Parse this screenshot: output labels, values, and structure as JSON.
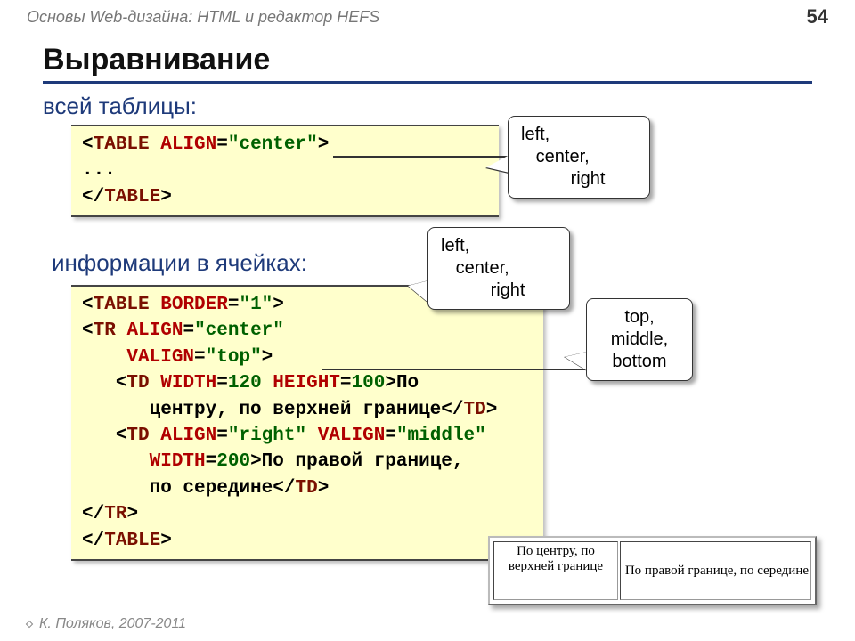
{
  "header": {
    "doc_title": "Основы Web-дизайна: HTML и редактор HEFS",
    "page_number": "54"
  },
  "title": "Выравнивание",
  "subtitles": {
    "whole_table": "всей таблицы:",
    "cells": "информации в ячейках:"
  },
  "code1": {
    "open_bracket": "<",
    "tag1": "TABLE",
    "sp1": " ",
    "attr1": "ALIGN",
    "eq1": "=",
    "val1": "\"center\"",
    "close_bracket": ">",
    "ellipsis": "...",
    "close_open": "</",
    "tag2": "TABLE",
    "close_close": ">"
  },
  "code2": {
    "l1_a": "<",
    "l1_tag": "TABLE",
    "l1_sp": " ",
    "l1_attr": "BORDER",
    "l1_eq": "=",
    "l1_val": "\"1\"",
    "l1_b": ">",
    "l2_a": "<",
    "l2_tag": "TR",
    "l2_sp": " ",
    "l2_attr": "ALIGN",
    "l2_eq": "=",
    "l2_val": "\"center\"",
    "l3_pad": "    ",
    "l3_attr": "VALIGN",
    "l3_eq": "=",
    "l3_val": "\"top\"",
    "l3_b": ">",
    "l4_pad": "   ",
    "l4_a": "<",
    "l4_tag": "TD",
    "l4_sp": " ",
    "l4_attr1": "WIDTH",
    "l4_eq1": "=",
    "l4_v1": "120",
    "l4_sp2": " ",
    "l4_attr2": "HEIGHT",
    "l4_eq2": "=",
    "l4_v2": "100",
    "l4_b": ">",
    "l4_text": "По",
    "l5_pad": "      ",
    "l5_text": "центру, по верхней границе",
    "l5_a": "</",
    "l5_tag": "TD",
    "l5_b": ">",
    "l6_pad": "   ",
    "l6_a": "<",
    "l6_tag": "TD",
    "l6_sp": " ",
    "l6_attr1": "ALIGN",
    "l6_eq1": "=",
    "l6_v1": "\"right\"",
    "l6_sp2": " ",
    "l6_attr2": "VALIGN",
    "l6_eq2": "=",
    "l6_v2": "\"middle\"",
    "l7_pad": "      ",
    "l7_attr": "WIDTH",
    "l7_eq": "=",
    "l7_v": "200",
    "l7_b": ">",
    "l7_text": "По правой границе,",
    "l8_pad": "      ",
    "l8_text": "по середине",
    "l8_a": "</",
    "l8_tag": "TD",
    "l8_b": ">",
    "l9_a": "</",
    "l9_tag": "TR",
    "l9_b": ">",
    "l10_a": "</",
    "l10_tag": "TABLE",
    "l10_b": ">"
  },
  "callouts": {
    "align_values_1": "left,\n   center,\n          right",
    "align_values_2": "left,\n   center,\n          right",
    "valign_values": "top,\nmiddle,\nbottom"
  },
  "example": {
    "cell_a": "По центру, по верхней границе",
    "cell_b": "По правой границе, по середине"
  },
  "footer": "К. Поляков, 2007-2011"
}
